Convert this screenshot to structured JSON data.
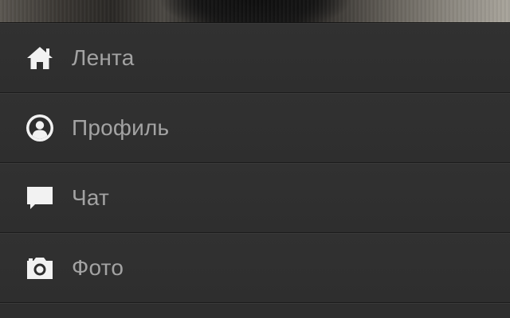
{
  "header": {
    "cover_photo": "profile-cover-photo"
  },
  "menu": {
    "items": [
      {
        "label": "Лента",
        "icon": "home-icon"
      },
      {
        "label": "Профиль",
        "icon": "profile-icon"
      },
      {
        "label": "Чат",
        "icon": "chat-icon"
      },
      {
        "label": "Фото",
        "icon": "camera-icon"
      }
    ]
  },
  "colors": {
    "background": "#2e2e2e",
    "label": "#a3a3a3",
    "icon": "#f2f2f2",
    "divider_dark": "#1b1b1b",
    "divider_light": "#3a3a3a"
  }
}
